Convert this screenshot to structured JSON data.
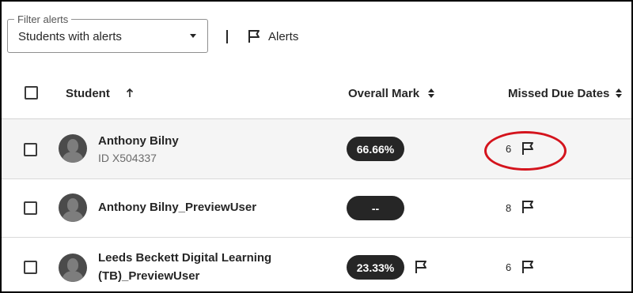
{
  "filter": {
    "legend": "Filter alerts",
    "value": "Students with alerts"
  },
  "alerts_link": {
    "label": "Alerts"
  },
  "header": {
    "student": "Student",
    "overall_mark": "Overall Mark",
    "missed_due_dates": "Missed Due Dates"
  },
  "rows": [
    {
      "name": "Anthony Bilny",
      "id": "ID X504337",
      "mark": "66.66%",
      "mark_flag": false,
      "missed": "6",
      "missed_flag": true
    },
    {
      "name": "Anthony Bilny_PreviewUser",
      "id": "",
      "mark": "--",
      "mark_flag": false,
      "missed": "8",
      "missed_flag": true
    },
    {
      "name_line1": "Leeds Beckett Digital Learning",
      "name_line2": "(TB)_PreviewUser",
      "mark": "23.33%",
      "mark_flag": true,
      "missed": "6",
      "missed_flag": true
    }
  ],
  "colors": {
    "pill_bg": "#262626",
    "annotation_circle": "#d4141d",
    "row_highlight": "#f5f5f5"
  },
  "icons": {
    "dropdown": "caret-down-icon",
    "alerts": "flag-icon",
    "sort_student": "arrow-up-icon",
    "sort_other": "sort-icon"
  }
}
